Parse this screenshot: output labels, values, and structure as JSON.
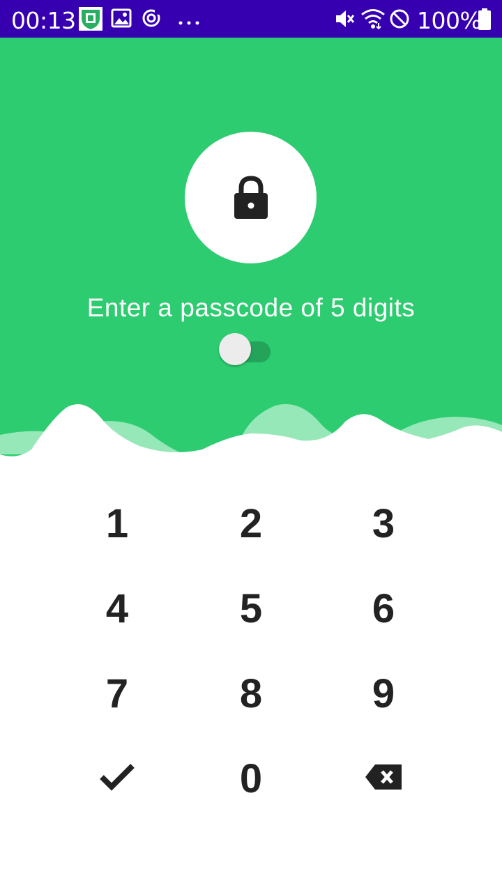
{
  "status_bar": {
    "time": "00:13",
    "battery_text": "100%",
    "icons": [
      "app-shield-icon",
      "gallery-icon",
      "sync-icon",
      "more-dots-icon",
      "vibrate-icon",
      "wifi-icon",
      "do-not-disturb-icon",
      "battery-icon"
    ],
    "background_color": "#3600b0"
  },
  "header": {
    "background_color": "#2ecc71",
    "icon": "lock-icon",
    "prompt": "Enter a passcode of 5 digits",
    "toggle": {
      "on": true
    }
  },
  "keypad": {
    "keys": [
      "1",
      "2",
      "3",
      "4",
      "5",
      "6",
      "7",
      "8",
      "9"
    ],
    "zero": "0",
    "confirm_icon": "check-icon",
    "delete_icon": "backspace-icon"
  }
}
